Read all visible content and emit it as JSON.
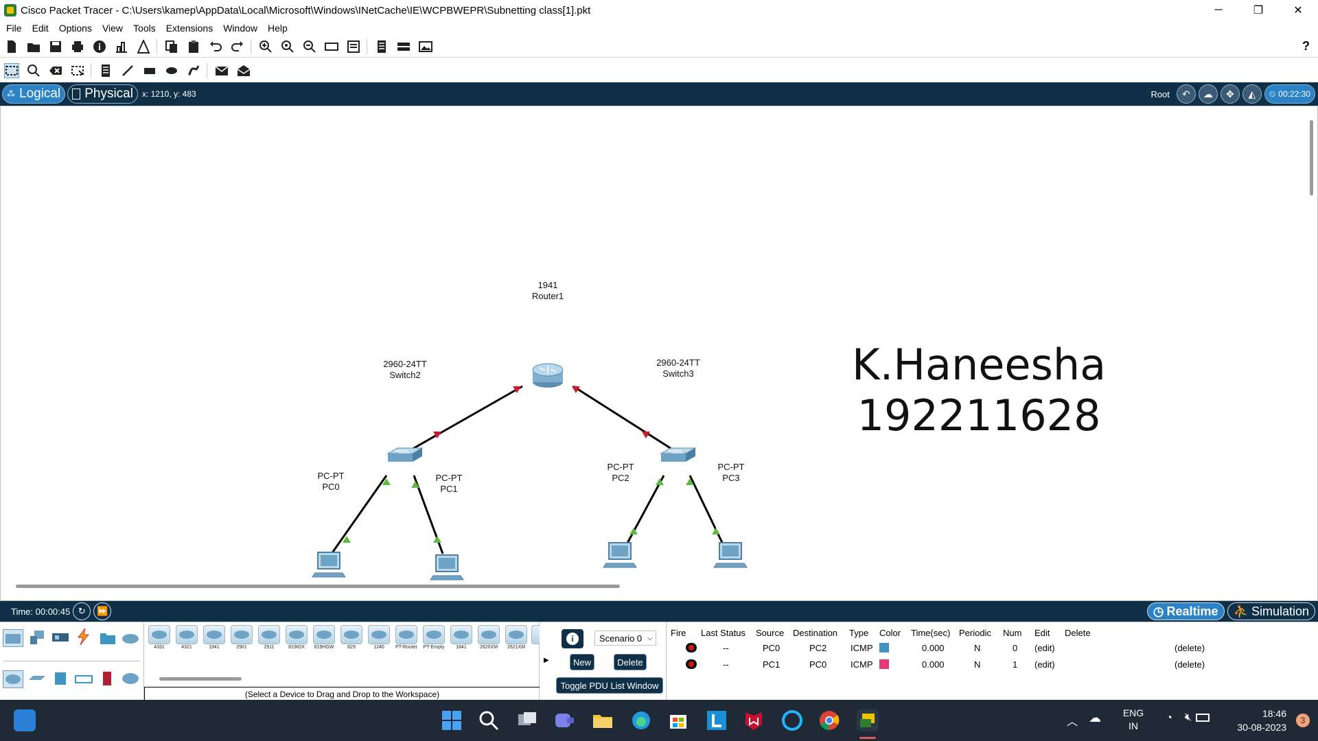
{
  "window": {
    "title": "Cisco Packet Tracer - C:\\Users\\kamep\\AppData\\Local\\Microsoft\\Windows\\INetCache\\IE\\WCPBWEPR\\Subnetting class[1].pkt",
    "minimize": "─",
    "restore": "❐",
    "close": "✕"
  },
  "menu": [
    "File",
    "Edit",
    "Options",
    "View",
    "Tools",
    "Extensions",
    "Window",
    "Help"
  ],
  "help_icon": "?",
  "nav": {
    "logical": "Logical",
    "physical": "Physical",
    "coords": "x: 1210, y: 483",
    "root": "Root",
    "clock": "00:22:30"
  },
  "devices": {
    "router": {
      "model": "1941",
      "name": "Router1"
    },
    "switch_left": {
      "model": "2960-24TT",
      "name": "Switch2"
    },
    "switch_right": {
      "model": "2960-24TT",
      "name": "Switch3"
    },
    "pc0": {
      "model": "PC-PT",
      "name": "PC0"
    },
    "pc1": {
      "model": "PC-PT",
      "name": "PC1"
    },
    "pc2": {
      "model": "PC-PT",
      "name": "PC2"
    },
    "pc3": {
      "model": "PC-PT",
      "name": "PC3"
    }
  },
  "watermark": {
    "name": "K.Haneesha",
    "id": "192211628"
  },
  "status": {
    "time": "Time: 00:00:45",
    "realtime": "Realtime",
    "simulation": "Simulation"
  },
  "device_list": [
    "4331",
    "4321",
    "1941",
    "2901",
    "2911",
    "819IOX",
    "819HGW",
    "829",
    "1240",
    "PT-Router",
    "PT-Empty",
    "1841",
    "2620XM",
    "2621XM"
  ],
  "device_hint": "(Select a Device to Drag and Drop to the Workspace)",
  "scenario": {
    "info": "i",
    "selected": "Scenario 0",
    "new": "New",
    "delete": "Delete",
    "toggle": "Toggle PDU List Window"
  },
  "pdu": {
    "headers": [
      "Fire",
      "Last Status",
      "Source",
      "Destination",
      "Type",
      "Color",
      "Time(sec)",
      "Periodic",
      "Num",
      "Edit",
      "Delete"
    ],
    "rows": [
      {
        "last_status": "--",
        "source": "PC0",
        "destination": "PC2",
        "type": "ICMP",
        "color": "#3f95c2",
        "time": "0.000",
        "periodic": "N",
        "num": "0",
        "edit": "(edit)",
        "delete": "(delete)"
      },
      {
        "last_status": "--",
        "source": "PC1",
        "destination": "PC0",
        "type": "ICMP",
        "color": "#e83a7a",
        "time": "0.000",
        "periodic": "N",
        "num": "1",
        "edit": "(edit)",
        "delete": "(delete)"
      }
    ]
  },
  "tray": {
    "lang1": "ENG",
    "lang2": "IN",
    "time": "18:46",
    "date": "30-08-2023",
    "badge": "3"
  }
}
